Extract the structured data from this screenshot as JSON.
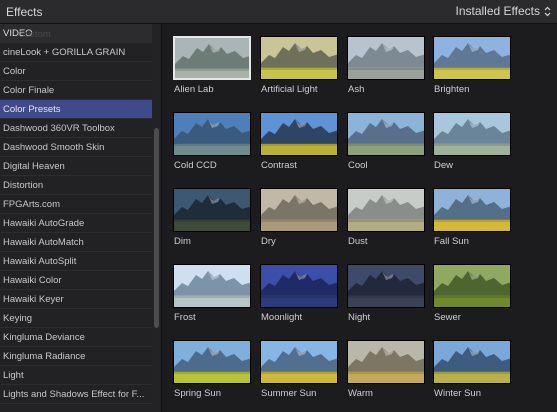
{
  "header": {
    "title": "Effects",
    "dropdown_label": "Installed Effects"
  },
  "sidebar": {
    "header_label": "VIDEO",
    "header_ghost": "Custom",
    "items": [
      "cineLook + GORILLA GRAIN",
      "Color",
      "Color Finale",
      "Color Presets",
      "Dashwood 360VR Toolbox",
      "Dashwood Smooth Skin",
      "Digital Heaven",
      "Distortion",
      "FPGArts.com",
      "Hawaiki AutoGrade",
      "Hawaiki AutoMatch",
      "Hawaiki AutoSplit",
      "Hawaiki Color",
      "Hawaiki Keyer",
      "Keying",
      "Kingluma Deviance",
      "Kingluma Radiance",
      "Light",
      "Lights and Shadows Effect for F..."
    ],
    "selected_index": 3
  },
  "effects": [
    {
      "label": "Alien Lab",
      "sky": "#a9b6b5",
      "mtn": "#6e7c78",
      "field": "#a8b3a8",
      "selected": true
    },
    {
      "label": "Artificial Light",
      "sky": "#c9c596",
      "mtn": "#6f705a",
      "field": "#c6c24a"
    },
    {
      "label": "Ash",
      "sky": "#b7c4cf",
      "mtn": "#7d8a94",
      "field": "#9aa09a"
    },
    {
      "label": "Brighten",
      "sky": "#8fb3e0",
      "mtn": "#5f7896",
      "field": "#d0c54c"
    },
    {
      "label": "Cold CCD",
      "sky": "#4f7fb8",
      "mtn": "#3b5a80",
      "field": "#6f8c8f"
    },
    {
      "label": "Contrast",
      "sky": "#5f93d6",
      "mtn": "#2e4563",
      "field": "#b9b236"
    },
    {
      "label": "Cool",
      "sky": "#8cb4d8",
      "mtn": "#58708c",
      "field": "#8fa07a"
    },
    {
      "label": "Dew",
      "sky": "#a6c7dc",
      "mtn": "#6a8599",
      "field": "#9fb39a"
    },
    {
      "label": "Dim",
      "sky": "#3c5872",
      "mtn": "#1f2c39",
      "field": "#3e4a3a"
    },
    {
      "label": "Dry",
      "sky": "#c2b8a8",
      "mtn": "#7c7466",
      "field": "#a99a7a"
    },
    {
      "label": "Dust",
      "sky": "#c7ccc8",
      "mtn": "#8a8e8a",
      "field": "#b2ad82"
    },
    {
      "label": "Fall Sun",
      "sky": "#8fb3d8",
      "mtn": "#556f88",
      "field": "#d3b93a"
    },
    {
      "label": "Frost",
      "sky": "#cfdff0",
      "mtn": "#7d93a8",
      "field": "#b9c6c9"
    },
    {
      "label": "Moonlight",
      "sky": "#3b4fa8",
      "mtn": "#202a66",
      "field": "#2e3b7a"
    },
    {
      "label": "Night",
      "sky": "#3d4a6a",
      "mtn": "#22293d",
      "field": "#3a4355"
    },
    {
      "label": "Sewer",
      "sky": "#8fa862",
      "mtn": "#4e6530",
      "field": "#6f8a2e"
    },
    {
      "label": "Spring Sun",
      "sky": "#7fb0dc",
      "mtn": "#4d6b8a",
      "field": "#b7c43a"
    },
    {
      "label": "Summer Sun",
      "sky": "#86b6e6",
      "mtn": "#526f8f",
      "field": "#d0b83c"
    },
    {
      "label": "Warm",
      "sky": "#b9b7a8",
      "mtn": "#7b7764",
      "field": "#c3aa5a"
    },
    {
      "label": "Winter Sun",
      "sky": "#7aa8d8",
      "mtn": "#3e5c80",
      "field": "#b8b04a"
    }
  ]
}
